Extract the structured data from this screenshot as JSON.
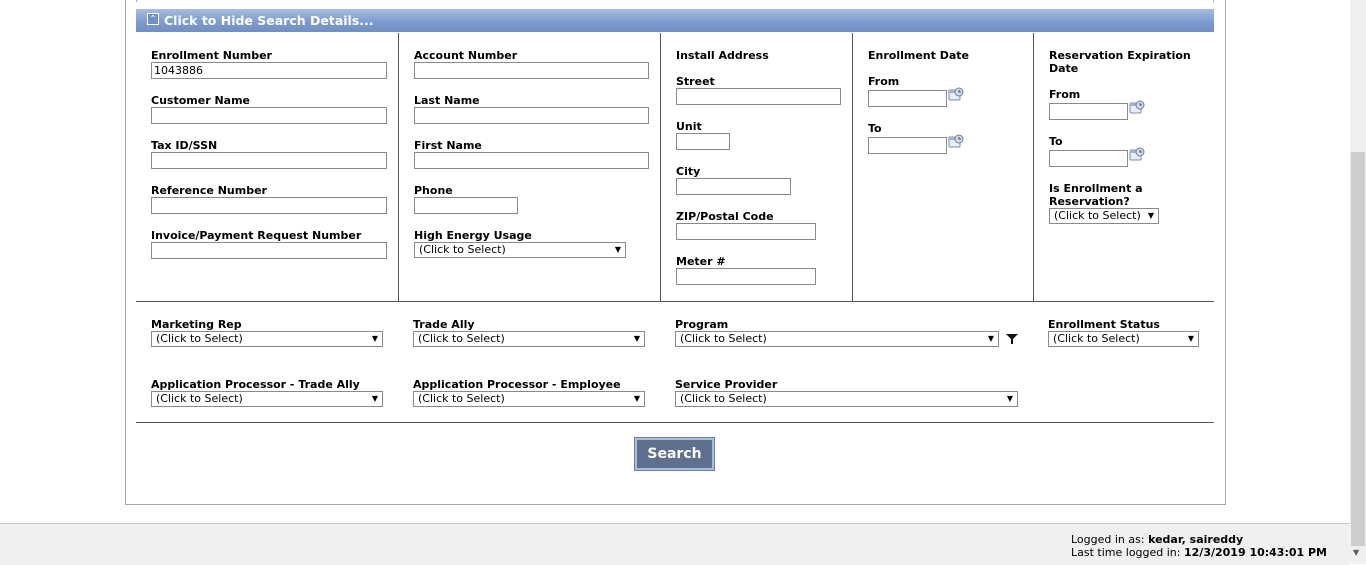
{
  "panel": {
    "header_label": "Click to Hide Search Details...",
    "header_icon": "collapse-up-icon"
  },
  "col1": {
    "enrollment_number": {
      "label": "Enrollment Number",
      "value": "1043886"
    },
    "customer_name": {
      "label": "Customer Name",
      "value": ""
    },
    "tax_id": {
      "label": "Tax ID/SSN",
      "value": ""
    },
    "reference_number": {
      "label": "Reference Number",
      "value": ""
    },
    "invoice_number": {
      "label": "Invoice/Payment Request Number",
      "value": ""
    }
  },
  "col2": {
    "account_number": {
      "label": "Account Number",
      "value": ""
    },
    "last_name": {
      "label": "Last Name",
      "value": ""
    },
    "first_name": {
      "label": "First Name",
      "value": ""
    },
    "phone": {
      "label": "Phone",
      "value": ""
    },
    "high_energy_usage": {
      "label": "High Energy Usage",
      "value": "(Click to Select)"
    }
  },
  "col3": {
    "title": "Install Address",
    "street": {
      "label": "Street",
      "value": ""
    },
    "unit": {
      "label": "Unit",
      "value": ""
    },
    "city": {
      "label": "City",
      "value": ""
    },
    "zip": {
      "label": "ZIP/Postal Code",
      "value": ""
    },
    "meter": {
      "label": "Meter #",
      "value": ""
    }
  },
  "col4": {
    "title": "Enrollment Date",
    "from": {
      "label": "From",
      "value": ""
    },
    "to": {
      "label": "To",
      "value": ""
    }
  },
  "col5": {
    "title_line1": "Reservation Expiration",
    "title_line2": "Date",
    "from": {
      "label": "From",
      "value": ""
    },
    "to": {
      "label": "To",
      "value": ""
    },
    "is_reservation_line1": "Is Enrollment a",
    "is_reservation_line2": "Reservation?",
    "is_reservation_value": "(Click to Select)"
  },
  "row2": {
    "marketing_rep": {
      "label": "Marketing Rep",
      "value": "(Click to Select)"
    },
    "trade_ally": {
      "label": "Trade Ally",
      "value": "(Click to Select)"
    },
    "program": {
      "label": "Program",
      "value": "(Click to Select)"
    },
    "enrollment_status": {
      "label": "Enrollment Status",
      "value": "(Click to Select)"
    },
    "app_proc_trade_ally": {
      "label": "Application Processor - Trade Ally",
      "value": "(Click to Select)"
    },
    "app_proc_employee": {
      "label": "Application Processor - Employee",
      "value": "(Click to Select)"
    },
    "service_provider": {
      "label": "Service Provider",
      "value": "(Click to Select)"
    }
  },
  "search_button": "Search",
  "footer": {
    "logged_in_label": "Logged in as: ",
    "logged_in_user": "kedar, saireddy",
    "last_login_label": "Last time logged in: ",
    "last_login_value": "12/3/2019 10:43:01 PM"
  },
  "icons": {
    "calendar": "calendar-icon",
    "filter": "filter-icon",
    "dropdown": "chevron-down-icon"
  },
  "colors": {
    "header_blue": "#7d9bd0",
    "button": "#5f6f8e"
  }
}
